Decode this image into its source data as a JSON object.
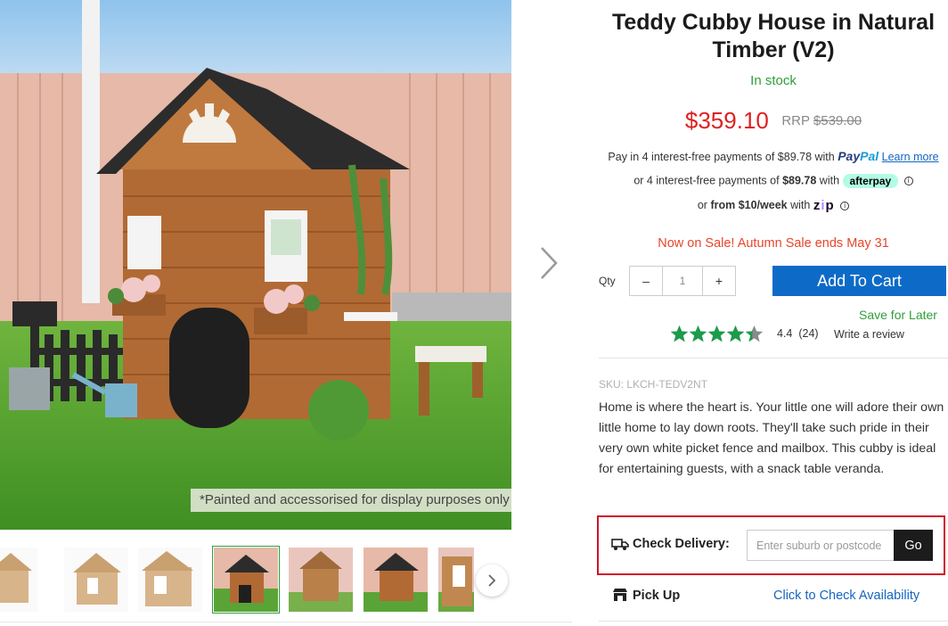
{
  "product": {
    "title": "Teddy Cubby House in Natural Timber (V2)",
    "stock_status": "In stock",
    "price": "$359.10",
    "rrp_label": "RRP",
    "rrp_value": "$539.00",
    "image_disclaimer": "*Painted and accessorised for display purposes only",
    "sku": "SKU: LKCH-TEDV2NT",
    "description": "Home is where the heart is. Your little one will adore their own little home to lay down roots. They'll take such pride in their very own white picket fence and mailbox. This cubby is ideal for entertaining guests, with a snack table veranda."
  },
  "payments": {
    "paypal_text": "Pay in 4 interest-free payments of $89.78 with",
    "paypal_logo_a": "Pay",
    "paypal_logo_b": "Pal",
    "paypal_learn_more": "Learn more",
    "afterpay_prefix": "or 4 interest-free payments of",
    "afterpay_amount": "$89.78",
    "afterpay_with": "with",
    "afterpay_logo": "afterpay",
    "zip_prefix": "or",
    "zip_amount": "from $10/week",
    "zip_with": "with",
    "zip_logo_a": "z",
    "zip_logo_b": "i",
    "zip_logo_c": "p"
  },
  "sale_banner": "Now on Sale! Autumn Sale ends May 31",
  "cart": {
    "qty_label": "Qty",
    "qty_minus": "–",
    "qty_value": "1",
    "qty_plus": "+",
    "add_to_cart": "Add To Cart",
    "save_for_later": "Save for Later"
  },
  "rating": {
    "value": 4.4,
    "max": 5,
    "score_text": "4.4",
    "count_text": "(24)",
    "write_review": "Write a review"
  },
  "delivery": {
    "label": "Check Delivery:",
    "placeholder": "Enter suburb or postcode",
    "go": "Go"
  },
  "pickup": {
    "label": "Pick Up",
    "link": "Click to Check Availability"
  },
  "thumbnails": {
    "selected_index": 3,
    "count": 7
  },
  "colors": {
    "price": "#e02020",
    "stock": "#2f9e3a",
    "accent_blue": "#0d6bc7",
    "sale": "#e8452b",
    "highlight_border": "#d3102b",
    "star": "#1a9c4a"
  }
}
